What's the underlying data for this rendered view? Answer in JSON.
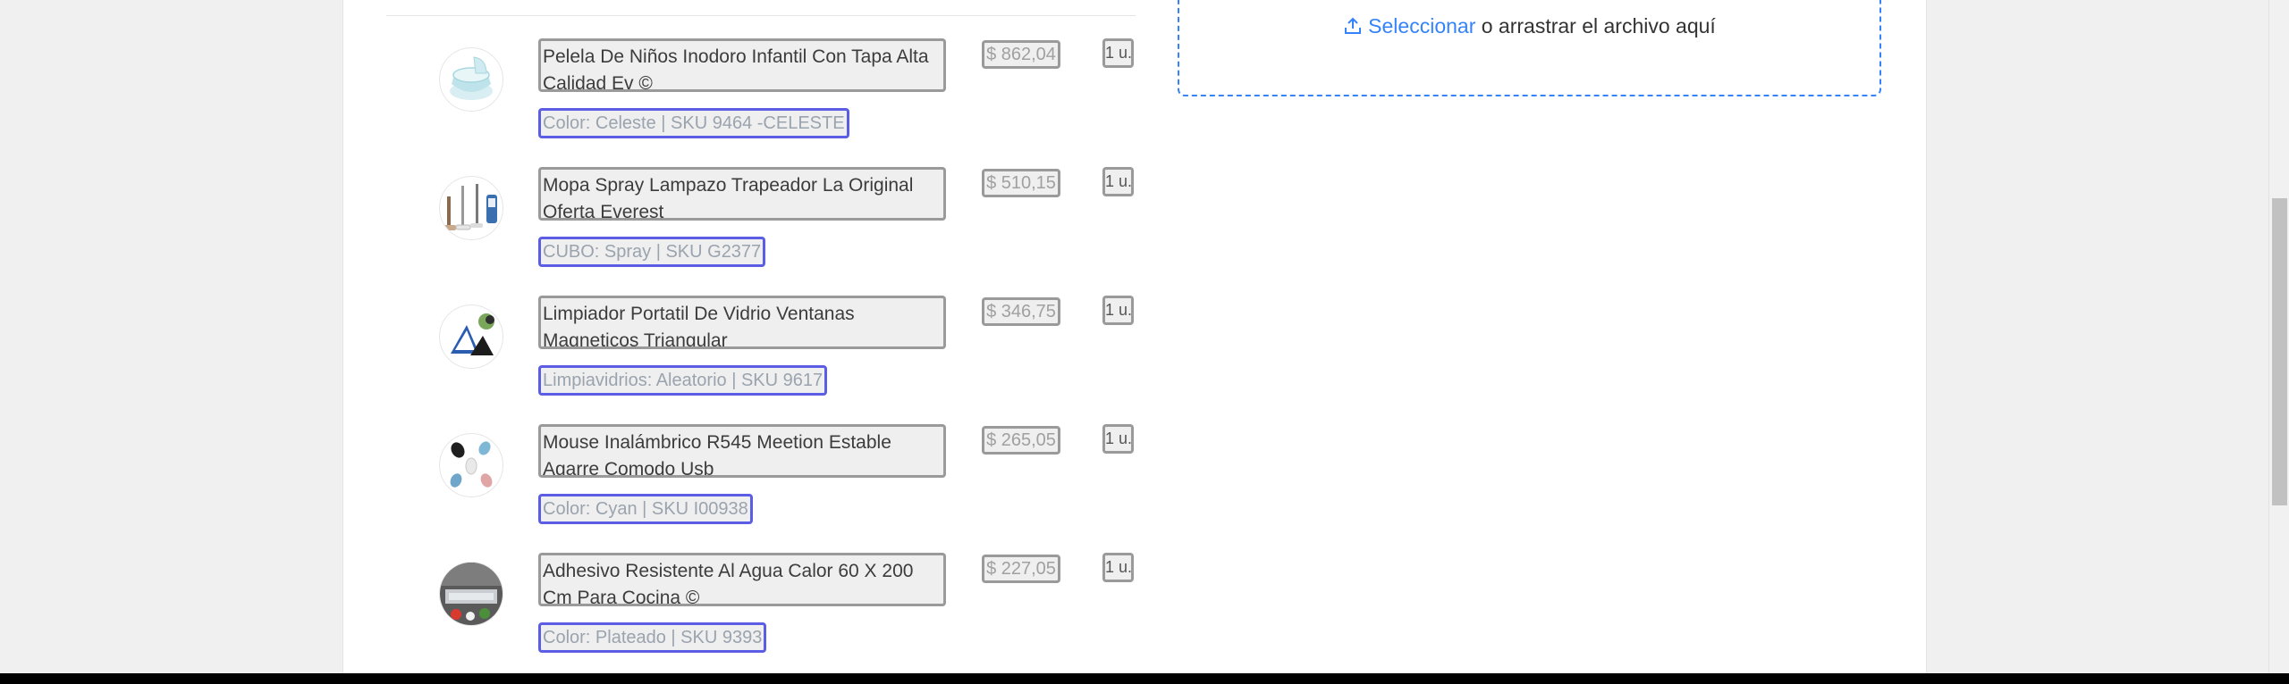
{
  "upload": {
    "link_text": "Seleccionar",
    "rest_text": " o arrastrar el archivo aquí",
    "icon": "upload-icon",
    "accent_color": "#3483fa"
  },
  "items": [
    {
      "title": "Pelela De Niños Inodoro Infantil Con Tapa Alta Calidad Ev ©",
      "variant": "Color: Celeste | SKU 9464 -CELESTE",
      "price": "$ 862,04",
      "qty": "1 u."
    },
    {
      "title": "Mopa Spray Lampazo Trapeador La Original Oferta Everest",
      "variant": "CUBO: Spray | SKU G2377",
      "price": "$ 510,15",
      "qty": "1 u."
    },
    {
      "title": "Limpiador Portatil De Vidrio Ventanas Magneticos Triangular",
      "variant": "Limpiavidrios: Aleatorio | SKU 9617",
      "price": "$ 346,75",
      "qty": "1 u."
    },
    {
      "title": "Mouse Inalámbrico R545 Meetion Estable Agarre Comodo Usb",
      "variant": "Color: Cyan | SKU I00938",
      "price": "$ 265,05",
      "qty": "1 u."
    },
    {
      "title": "Adhesivo Resistente Al Agua Calor 60 X 200 Cm Para Cocina ©",
      "variant": "Color: Plateado | SKU 9393",
      "price": "$ 227,05",
      "qty": "1 u."
    }
  ],
  "colors": {
    "variant_border": "#5b5ee4",
    "field_border": "#9a9a9a",
    "field_bg": "#efefef"
  }
}
